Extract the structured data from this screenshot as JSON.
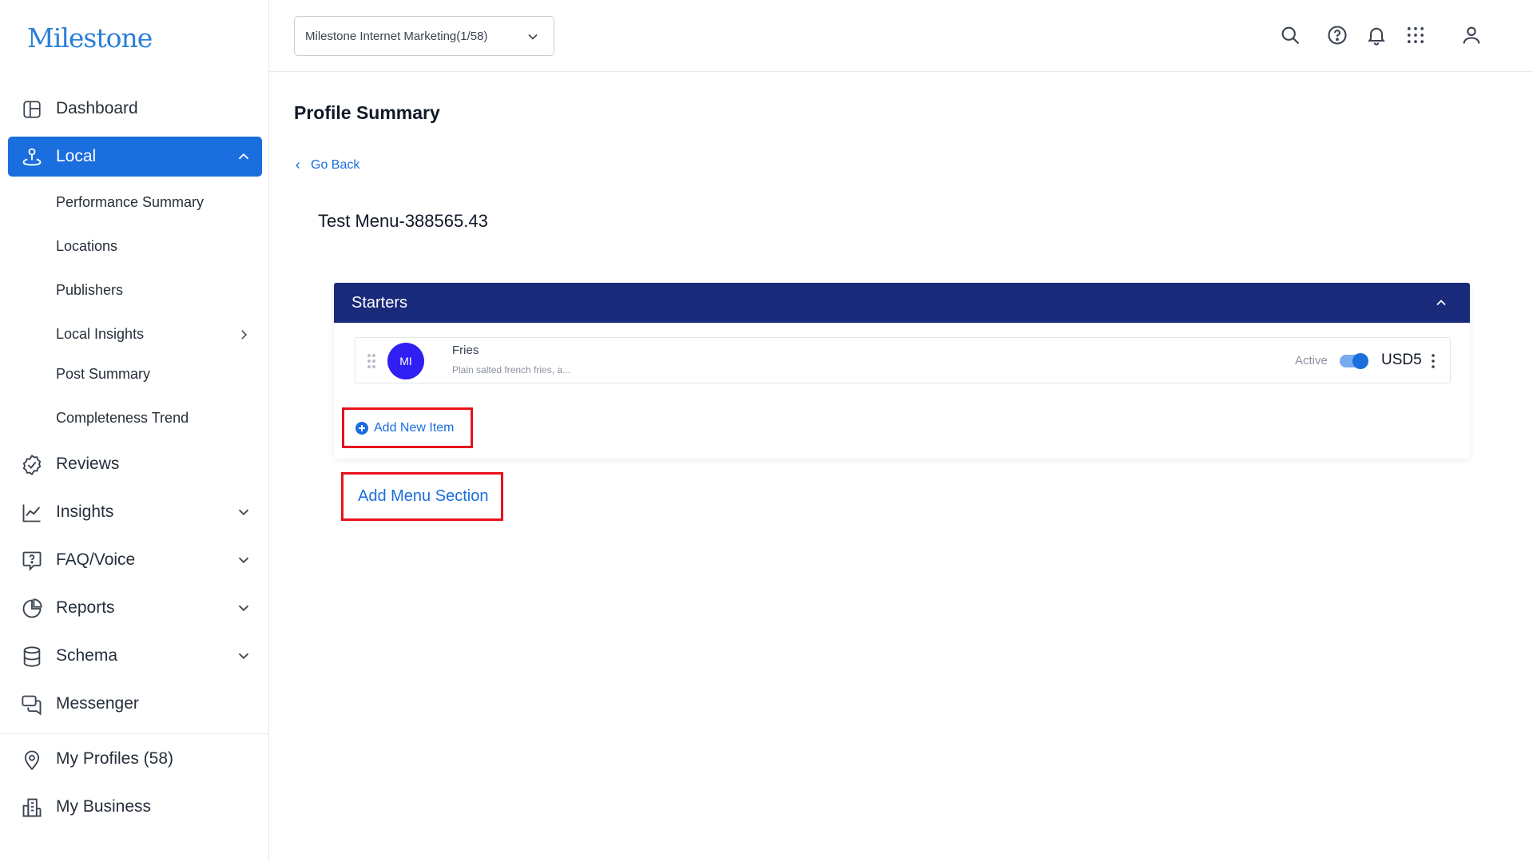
{
  "brand": {
    "logo_text": "Milestone",
    "accent": "#1a6ede",
    "section_header_color": "#1a2a7a",
    "highlight_border": "#e8121c"
  },
  "sidebar": {
    "items": [
      {
        "label": "Dashboard",
        "icon": "dashboard-icon"
      },
      {
        "label": "Local",
        "icon": "location-pin-icon",
        "active": true,
        "expanded": true
      },
      {
        "label": "Reviews",
        "icon": "check-badge-icon"
      },
      {
        "label": "Insights",
        "icon": "line-chart-icon"
      },
      {
        "label": "FAQ/Voice",
        "icon": "question-chat-icon"
      },
      {
        "label": "Reports",
        "icon": "pie-chart-icon"
      },
      {
        "label": "Schema",
        "icon": "database-icon"
      },
      {
        "label": "Messenger",
        "icon": "chat-bubbles-icon"
      },
      {
        "label": "My Profiles (58)",
        "icon": "map-pin-icon"
      },
      {
        "label": "My Business",
        "icon": "building-icon"
      }
    ],
    "local_sub": [
      {
        "label": "Performance Summary"
      },
      {
        "label": "Locations"
      },
      {
        "label": "Publishers"
      },
      {
        "label": "Local Insights"
      },
      {
        "label": "Post Summary"
      },
      {
        "label": "Completeness Trend"
      }
    ]
  },
  "header": {
    "org_select": "Milestone Internet Marketing(1/58)",
    "icons": [
      "search-icon",
      "help-icon",
      "bell-icon",
      "apps-grid-icon",
      "user-icon"
    ]
  },
  "main": {
    "page_title": "Profile Summary",
    "go_back": "Go Back",
    "menu_title": "Test Menu-388565.43",
    "section": {
      "title": "Starters",
      "items": [
        {
          "avatar_initials": "MI",
          "name": "Fries",
          "description": "Plain salted french fries, a...",
          "status": "Active",
          "active": true,
          "price": "USD5"
        }
      ],
      "add_item_label": "Add New Item"
    },
    "add_section_label": "Add Menu Section"
  }
}
